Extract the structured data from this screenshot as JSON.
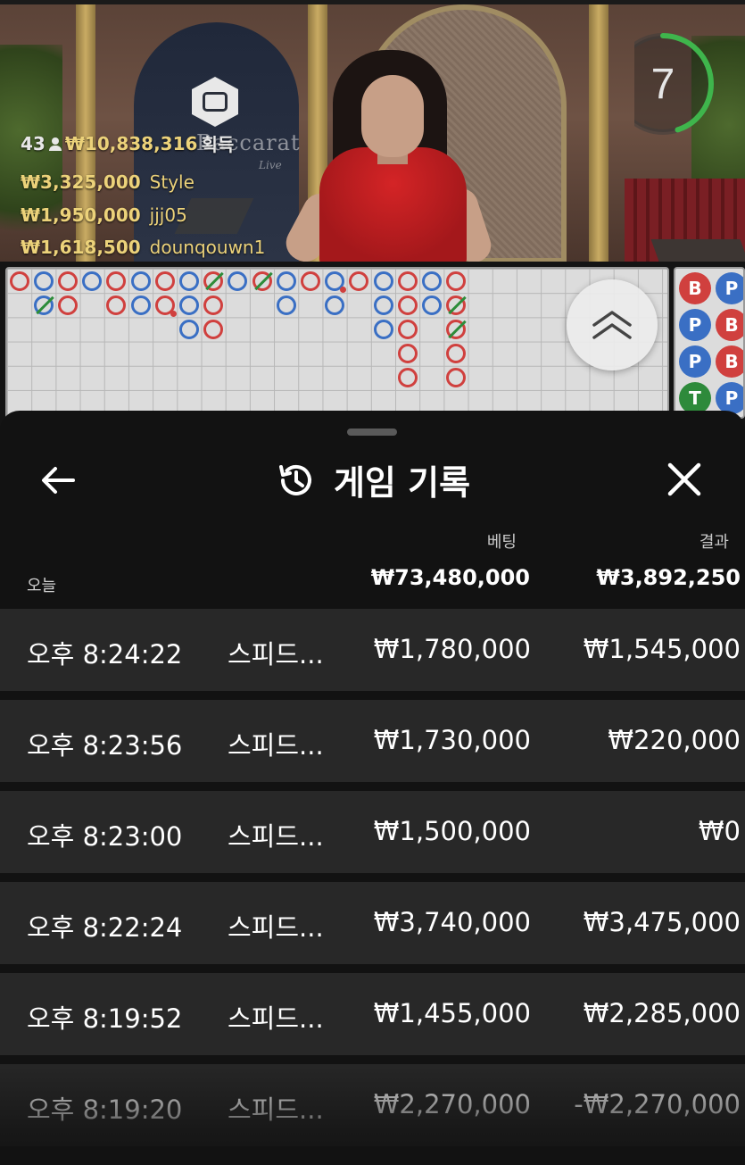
{
  "video": {
    "brand": "Baccarat",
    "brand_sub": "Live",
    "win_summary": {
      "players": "43",
      "amount": "₩10,838,316",
      "suffix": "획득"
    },
    "top_winners": [
      {
        "amount": "₩3,325,000",
        "name": "Style"
      },
      {
        "amount": "₩1,950,000",
        "name": "jjj05"
      },
      {
        "amount": "₩1,618,500",
        "name": "dounqouwn1"
      }
    ],
    "timer": {
      "value": "7",
      "fraction": 0.45,
      "color": "#3fb54c"
    }
  },
  "road": {
    "colors": {
      "banker": "#d0403e",
      "player": "#3a6fc4",
      "tie": "#2d8c3a"
    },
    "side_beads": [
      {
        "col": 0,
        "row": 0,
        "label": "B"
      },
      {
        "col": 1,
        "row": 0,
        "label": "P"
      },
      {
        "col": 0,
        "row": 1,
        "label": "P"
      },
      {
        "col": 1,
        "row": 1,
        "label": "B"
      },
      {
        "col": 0,
        "row": 2,
        "label": "P"
      },
      {
        "col": 1,
        "row": 2,
        "label": "B"
      },
      {
        "col": 0,
        "row": 3,
        "label": "T"
      },
      {
        "col": 1,
        "row": 3,
        "label": "P"
      }
    ]
  },
  "panel": {
    "title": "게임 기록",
    "back_icon": "arrow-left-icon",
    "history_icon": "history-icon",
    "close_icon": "close-icon",
    "columns": {
      "bet": "베팅",
      "result": "결과"
    },
    "summary": {
      "label": "오늘",
      "bet": "₩73,480,000",
      "result": "₩3,892,250"
    },
    "rows": [
      {
        "time": "오후 8:24:22",
        "game": "스피드...",
        "bet": "₩1,780,000",
        "result": "₩1,545,000"
      },
      {
        "time": "오후 8:23:56",
        "game": "스피드...",
        "bet": "₩1,730,000",
        "result": "₩220,000"
      },
      {
        "time": "오후 8:23:00",
        "game": "스피드...",
        "bet": "₩1,500,000",
        "result": "₩0"
      },
      {
        "time": "오후 8:22:24",
        "game": "스피드...",
        "bet": "₩3,740,000",
        "result": "₩3,475,000"
      },
      {
        "time": "오후 8:19:52",
        "game": "스피드...",
        "bet": "₩1,455,000",
        "result": "₩2,285,000"
      },
      {
        "time": "오후 8:19:20",
        "game": "스피드...",
        "bet": "₩2,270,000",
        "result": "-₩2,270,000"
      }
    ]
  }
}
